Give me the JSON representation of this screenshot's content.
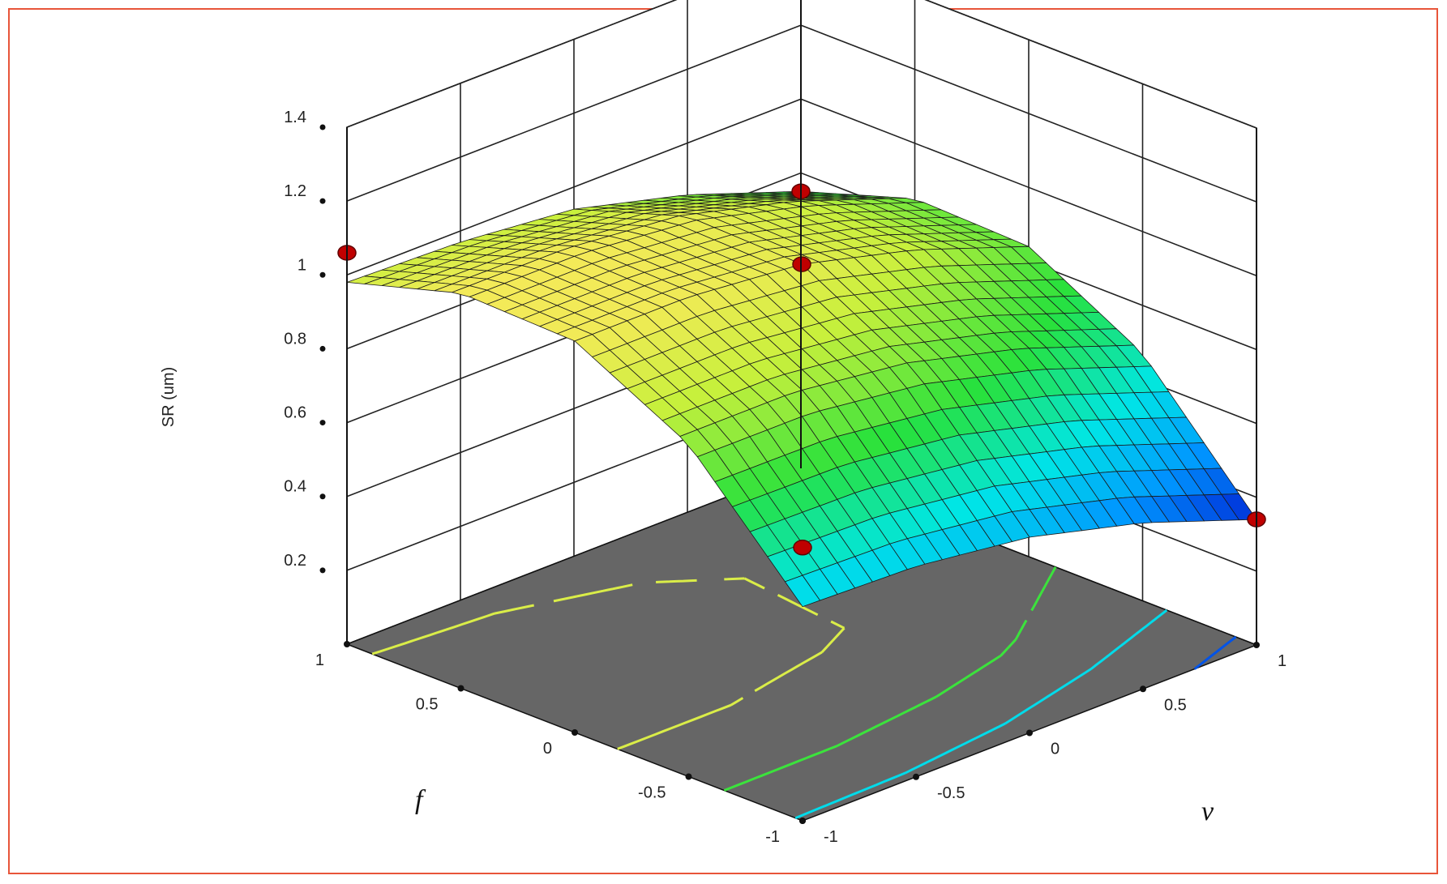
{
  "chart_data": {
    "type": "surface3d",
    "zlabel": "SR (um)",
    "xlabel": "f",
    "ylabel": "v",
    "x_range": [
      -1,
      1
    ],
    "y_range": [
      -1,
      1
    ],
    "zlim": [
      0,
      1.4
    ],
    "x_ticks": [
      "-1",
      "-0.5",
      "0",
      "0.5",
      "1"
    ],
    "y_ticks": [
      "-1",
      "-0.5",
      "0",
      "0.5",
      "1"
    ],
    "z_ticks": [
      "0.2",
      "0.4",
      "0.6",
      "0.8",
      "1",
      "1.2",
      "1.4"
    ],
    "grid": true,
    "colormap": [
      "#0000c8",
      "#00a0ff",
      "#00e6e6",
      "#30e040",
      "#c8f040",
      "#ffe860"
    ],
    "floor_color": "#666666",
    "surface_samples": {
      "f": [
        -1,
        -0.5,
        0,
        0.5,
        1
      ],
      "v": [
        -1,
        -0.5,
        0,
        0.5,
        1
      ],
      "z_by_f_then_v": [
        [
          0.58,
          0.57,
          0.53,
          0.45,
          0.34
        ],
        [
          0.9,
          0.9,
          0.86,
          0.78,
          0.67
        ],
        [
          1.06,
          1.06,
          1.03,
          0.95,
          0.84
        ],
        [
          1.07,
          1.07,
          1.04,
          0.96,
          0.85
        ],
        [
          0.98,
          0.97,
          0.94,
          0.86,
          0.75
        ]
      ]
    },
    "design_points": [
      {
        "f": -1,
        "v": -1,
        "z": 0.74
      },
      {
        "f": 1,
        "v": -1,
        "z": 1.06
      },
      {
        "f": 0,
        "v": 0,
        "z": 1.03
      },
      {
        "f": -1,
        "v": 1,
        "z": 0.34
      },
      {
        "f": 1,
        "v": 1,
        "z": 0.75
      }
    ],
    "contour_levels": [
      0.4,
      0.6,
      0.8,
      1.0
    ]
  }
}
